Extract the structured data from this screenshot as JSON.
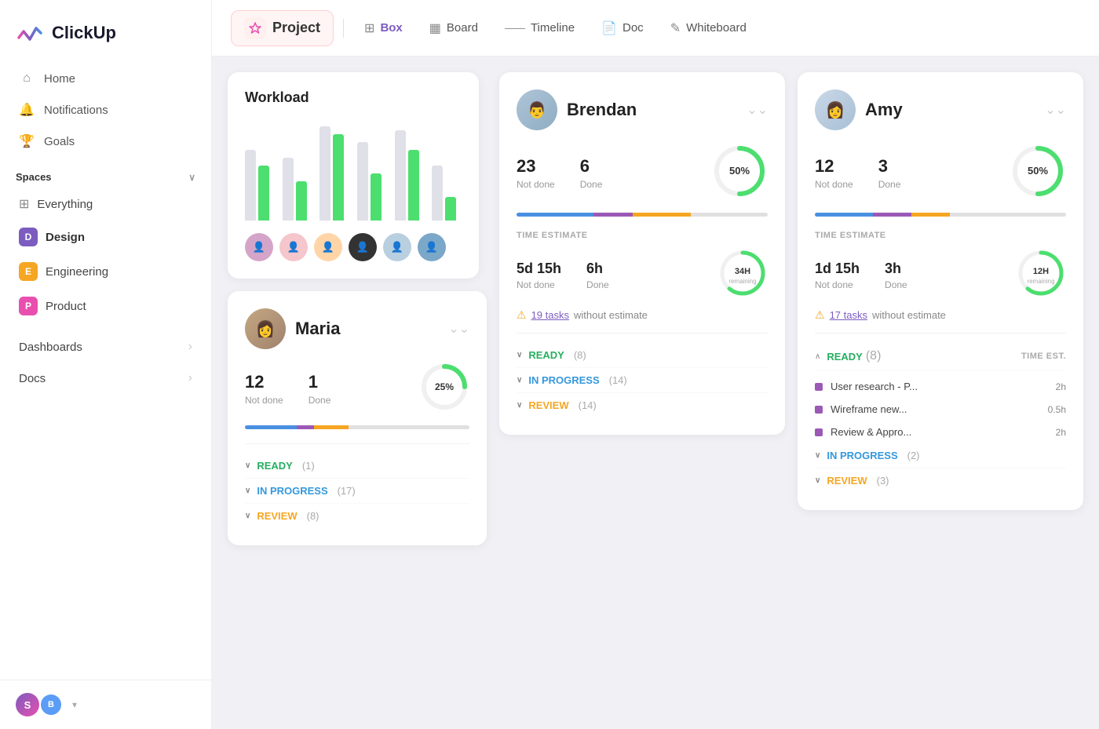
{
  "logo": {
    "text": "ClickUp"
  },
  "sidebar": {
    "nav": [
      {
        "id": "home",
        "label": "Home",
        "icon": "⌂"
      },
      {
        "id": "notifications",
        "label": "Notifications",
        "icon": "🔔"
      },
      {
        "id": "goals",
        "label": "Goals",
        "icon": "🏆"
      }
    ],
    "spaces_label": "Spaces",
    "spaces": [
      {
        "id": "everything",
        "label": "Everything",
        "icon": "⊞",
        "prefix": "0"
      },
      {
        "id": "design",
        "label": "Design",
        "badge": "D",
        "class": "design"
      },
      {
        "id": "engineering",
        "label": "Engineering",
        "badge": "E",
        "class": "engineering"
      },
      {
        "id": "product",
        "label": "Product",
        "badge": "P",
        "class": "product"
      }
    ],
    "bottom_nav": [
      {
        "id": "dashboards",
        "label": "Dashboards",
        "arrow": "›"
      },
      {
        "id": "docs",
        "label": "Docs",
        "arrow": "›"
      }
    ]
  },
  "topbar": {
    "project_label": "Project",
    "tabs": [
      {
        "id": "box",
        "label": "Box",
        "icon": "⊞"
      },
      {
        "id": "board",
        "label": "Board",
        "icon": "▦"
      },
      {
        "id": "timeline",
        "label": "Timeline",
        "icon": "—"
      },
      {
        "id": "doc",
        "label": "Doc",
        "icon": "📄"
      },
      {
        "id": "whiteboard",
        "label": "Whiteboard",
        "icon": "✎"
      }
    ]
  },
  "workload": {
    "title": "Workload",
    "bars": [
      {
        "green": 70,
        "gray": 90
      },
      {
        "green": 50,
        "gray": 80
      },
      {
        "green": 110,
        "gray": 120
      },
      {
        "green": 60,
        "gray": 100
      },
      {
        "green": 90,
        "gray": 115
      },
      {
        "green": 30,
        "gray": 70
      }
    ]
  },
  "brendan": {
    "name": "Brendan",
    "not_done": 23,
    "not_done_label": "Not done",
    "done": 6,
    "done_label": "Done",
    "percent": 50,
    "percent_label": "50%",
    "time_estimate_label": "TIME ESTIMATE",
    "time_not_done": "5d 15h",
    "time_not_done_label": "Not done",
    "time_done": "6h",
    "time_done_label": "Done",
    "remaining": "34H",
    "remaining_sub": "remaining",
    "warning_prefix": "19 tasks",
    "warning_suffix": " without estimate",
    "statuses": [
      {
        "id": "ready",
        "label": "READY",
        "count": "(8)",
        "color": "ready"
      },
      {
        "id": "inprogress",
        "label": "IN PROGRESS",
        "count": "(14)",
        "color": "inprogress"
      },
      {
        "id": "review",
        "label": "REVIEW",
        "count": "(14)",
        "color": "review"
      }
    ]
  },
  "amy": {
    "name": "Amy",
    "not_done": 12,
    "not_done_label": "Not done",
    "done": 3,
    "done_label": "Done",
    "percent": 50,
    "percent_label": "50%",
    "time_estimate_label": "TIME ESTIMATE",
    "time_not_done": "1d 15h",
    "time_not_done_label": "Not done",
    "time_done": "3h",
    "time_done_label": "Done",
    "remaining": "12H",
    "remaining_sub": "remaining",
    "warning_prefix": "17 tasks",
    "warning_suffix": " without estimate",
    "ready_label": "READY",
    "ready_count": "(8)",
    "time_est_col": "TIME EST.",
    "tasks": [
      {
        "name": "User research - P...",
        "time": "2h"
      },
      {
        "name": "Wireframe new...",
        "time": "0.5h"
      },
      {
        "name": "Review & Appro...",
        "time": "2h"
      }
    ],
    "statuses": [
      {
        "id": "inprogress",
        "label": "IN PROGRESS",
        "count": "(2)",
        "color": "inprogress"
      },
      {
        "id": "review",
        "label": "REVIEW",
        "count": "(3)",
        "color": "review"
      }
    ]
  },
  "maria": {
    "name": "Maria",
    "not_done": 12,
    "not_done_label": "Not done",
    "done": 1,
    "done_label": "Done",
    "percent": 25,
    "percent_label": "25%",
    "statuses": [
      {
        "id": "ready",
        "label": "READY",
        "count": "(1)",
        "color": "ready"
      },
      {
        "id": "inprogress",
        "label": "IN PROGRESS",
        "count": "(17)",
        "color": "inprogress"
      },
      {
        "id": "review",
        "label": "REVIEW",
        "count": "(8)",
        "color": "review"
      }
    ]
  }
}
